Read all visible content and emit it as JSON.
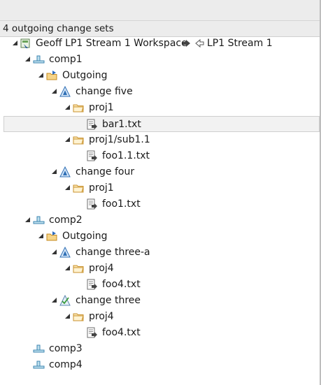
{
  "header": {
    "title": "4 outgoing change sets"
  },
  "tree": [
    {
      "label": "Geoff LP1 Stream 1 Workspace",
      "stream": "LP1 Stream 1",
      "icon": "workspace-icon",
      "expanded": true
    },
    {
      "label": "comp1",
      "icon": "component-icon",
      "expanded": true
    },
    {
      "label": "Outgoing",
      "icon": "outgoing-folder-icon",
      "expanded": true
    },
    {
      "label": "change five",
      "icon": "change-set-icon",
      "expanded": true
    },
    {
      "label": "proj1",
      "icon": "folder-icon",
      "expanded": true
    },
    {
      "label": "bar1.txt",
      "icon": "file-change-icon",
      "selected": true
    },
    {
      "label": "proj1/sub1.1",
      "icon": "folder-icon",
      "expanded": true
    },
    {
      "label": "foo1.1.txt",
      "icon": "file-change-icon"
    },
    {
      "label": "change four",
      "icon": "change-set-icon",
      "expanded": true
    },
    {
      "label": "proj1",
      "icon": "folder-icon",
      "expanded": true
    },
    {
      "label": "foo1.txt",
      "icon": "file-change-icon"
    },
    {
      "label": "comp2",
      "icon": "component-icon",
      "expanded": true
    },
    {
      "label": "Outgoing",
      "icon": "outgoing-folder-icon",
      "expanded": true
    },
    {
      "label": "change three-a",
      "icon": "change-set-icon",
      "expanded": true
    },
    {
      "label": "proj4",
      "icon": "folder-icon",
      "expanded": true
    },
    {
      "label": "foo4.txt",
      "icon": "file-change-icon"
    },
    {
      "label": "change three",
      "icon": "change-set-complete-icon",
      "expanded": true
    },
    {
      "label": "proj4",
      "icon": "folder-icon",
      "expanded": true
    },
    {
      "label": "foo4.txt",
      "icon": "file-change-icon"
    },
    {
      "label": "comp3",
      "icon": "component-icon"
    },
    {
      "label": "comp4",
      "icon": "component-icon"
    }
  ]
}
